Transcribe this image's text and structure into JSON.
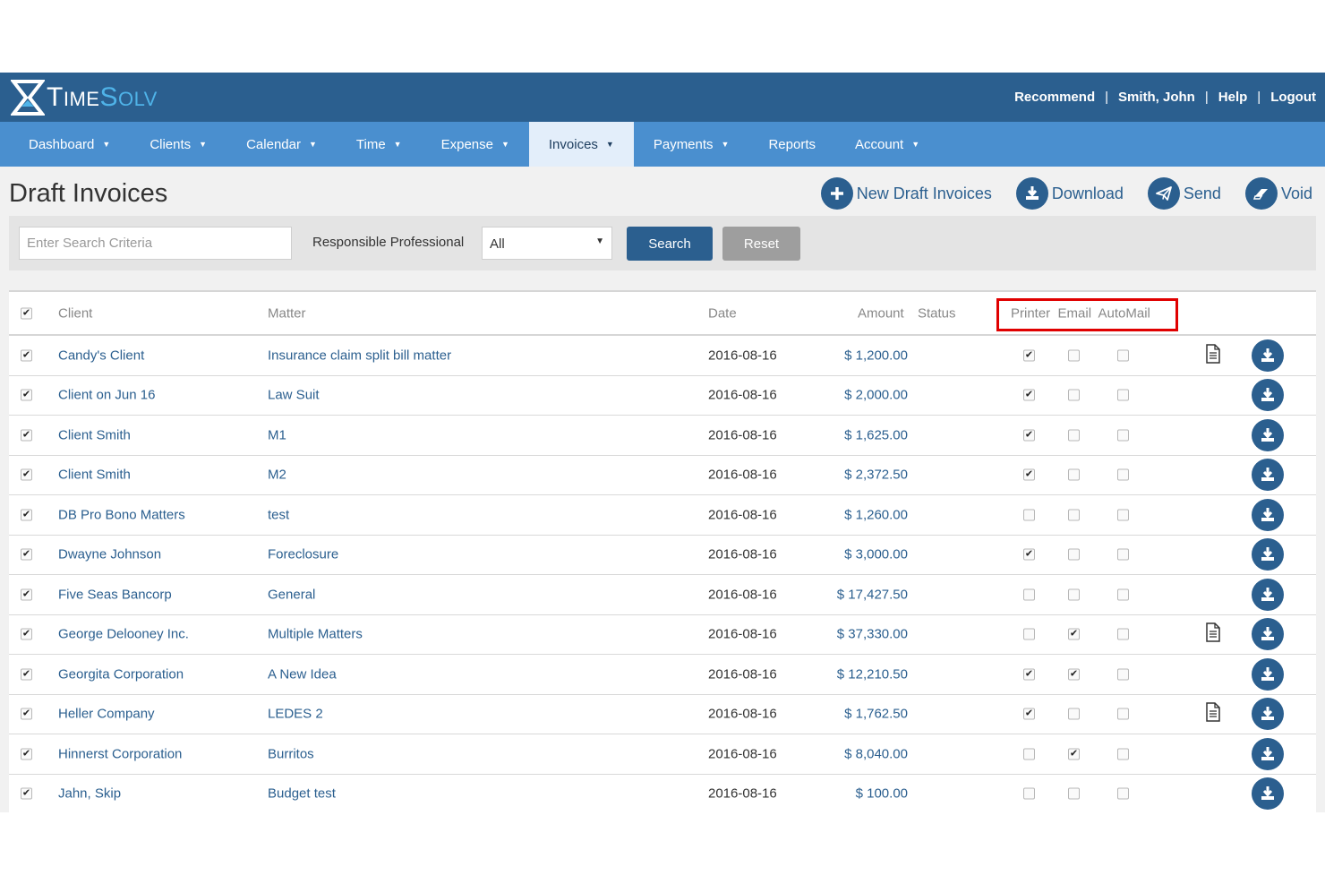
{
  "header": {
    "logo": {
      "t1": "T",
      "t2": "IME",
      "t3": "S",
      "t4": "OLV"
    },
    "links": [
      "Recommend",
      "Smith, John",
      "Help",
      "Logout"
    ]
  },
  "nav": [
    {
      "label": "Dashboard",
      "caret": true
    },
    {
      "label": "Clients",
      "caret": true
    },
    {
      "label": "Calendar",
      "caret": true
    },
    {
      "label": "Time",
      "caret": true
    },
    {
      "label": "Expense",
      "caret": true
    },
    {
      "label": "Invoices",
      "caret": true,
      "active": true
    },
    {
      "label": "Payments",
      "caret": true
    },
    {
      "label": "Reports",
      "caret": false
    },
    {
      "label": "Account",
      "caret": true
    }
  ],
  "page": {
    "title": "Draft Invoices",
    "actions": [
      {
        "label": "New Draft Invoices",
        "icon": "plus-icon"
      },
      {
        "label": "Download",
        "icon": "download-icon"
      },
      {
        "label": "Send",
        "icon": "paper-plane-icon"
      },
      {
        "label": "Void",
        "icon": "eraser-icon"
      }
    ]
  },
  "search": {
    "placeholder": "Enter Search Criteria",
    "value": "",
    "responsible_label": "Responsible Professional",
    "responsible_value": "All",
    "search_label": "Search",
    "reset_label": "Reset"
  },
  "table": {
    "headers": {
      "client": "Client",
      "matter": "Matter",
      "date": "Date",
      "amount": "Amount",
      "status": "Status",
      "delivery": "Printer  Email  AutoMail"
    },
    "select_all": true,
    "rows": [
      {
        "client": "Candy's Client",
        "matter": "Insurance claim split bill matter",
        "date": "2016-08-16",
        "amount": "$ 1,200.00",
        "status": "",
        "printer": true,
        "email": false,
        "automail": false,
        "doc": true,
        "selected": true
      },
      {
        "client": "Client on Jun 16",
        "matter": "Law Suit",
        "date": "2016-08-16",
        "amount": "$ 2,000.00",
        "status": "",
        "printer": true,
        "email": false,
        "automail": false,
        "doc": false,
        "selected": true
      },
      {
        "client": "Client Smith",
        "matter": "M1",
        "date": "2016-08-16",
        "amount": "$ 1,625.00",
        "status": "",
        "printer": true,
        "email": false,
        "automail": false,
        "doc": false,
        "selected": true
      },
      {
        "client": "Client Smith",
        "matter": "M2",
        "date": "2016-08-16",
        "amount": "$ 2,372.50",
        "status": "",
        "printer": true,
        "email": false,
        "automail": false,
        "doc": false,
        "selected": true
      },
      {
        "client": "DB Pro Bono Matters",
        "matter": "test",
        "date": "2016-08-16",
        "amount": "$ 1,260.00",
        "status": "",
        "printer": false,
        "email": false,
        "automail": false,
        "doc": false,
        "selected": true
      },
      {
        "client": "Dwayne Johnson",
        "matter": "Foreclosure",
        "date": "2016-08-16",
        "amount": "$ 3,000.00",
        "status": "",
        "printer": true,
        "email": false,
        "automail": false,
        "doc": false,
        "selected": true
      },
      {
        "client": "Five Seas Bancorp",
        "matter": "General",
        "date": "2016-08-16",
        "amount": "$ 17,427.50",
        "status": "",
        "printer": false,
        "email": false,
        "automail": false,
        "doc": false,
        "selected": true
      },
      {
        "client": "George Delooney Inc.",
        "matter": "Multiple Matters",
        "date": "2016-08-16",
        "amount": "$ 37,330.00",
        "status": "",
        "printer": false,
        "email": true,
        "automail": false,
        "doc": true,
        "selected": true
      },
      {
        "client": "Georgita Corporation",
        "matter": "A New Idea",
        "date": "2016-08-16",
        "amount": "$ 12,210.50",
        "status": "",
        "printer": true,
        "email": true,
        "automail": false,
        "doc": false,
        "selected": true
      },
      {
        "client": "Heller Company",
        "matter": "LEDES 2",
        "date": "2016-08-16",
        "amount": "$ 1,762.50",
        "status": "",
        "printer": true,
        "email": false,
        "automail": false,
        "doc": true,
        "selected": true
      },
      {
        "client": "Hinnerst Corporation",
        "matter": "Burritos",
        "date": "2016-08-16",
        "amount": "$ 8,040.00",
        "status": "",
        "printer": false,
        "email": true,
        "automail": false,
        "doc": false,
        "selected": true
      },
      {
        "client": "Jahn, Skip",
        "matter": "Budget test",
        "date": "2016-08-16",
        "amount": "$ 100.00",
        "status": "",
        "printer": false,
        "email": false,
        "automail": false,
        "doc": false,
        "selected": true
      }
    ]
  },
  "colors": {
    "brand_dark": "#2b5f8f",
    "nav": "#4a8fcf",
    "accent_logo": "#4fb3e8",
    "highlight": "#e00000"
  }
}
